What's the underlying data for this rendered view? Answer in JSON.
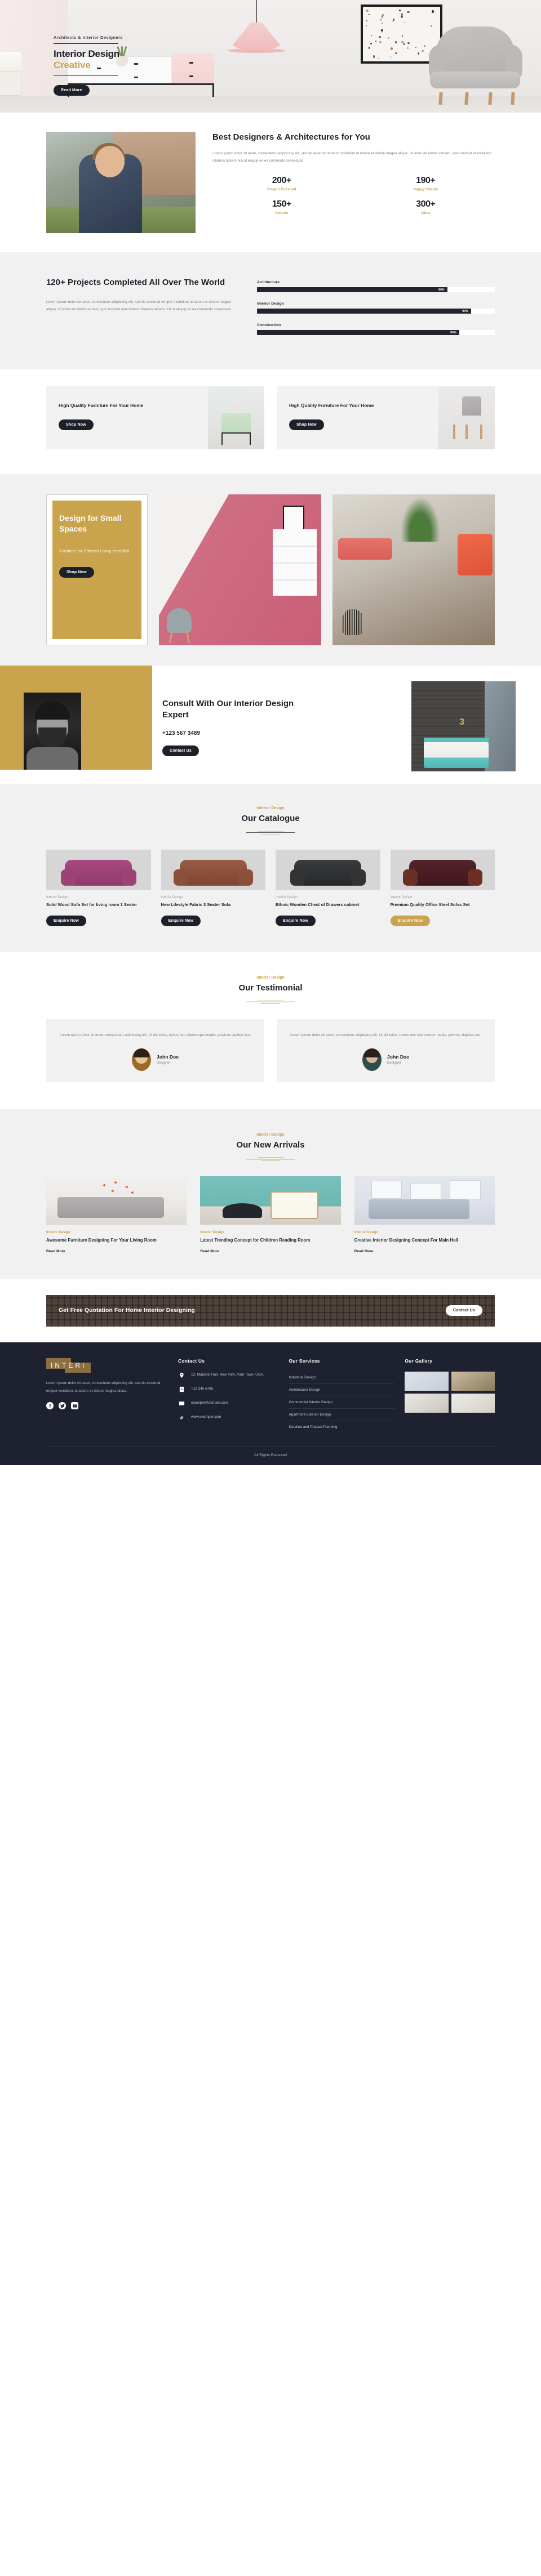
{
  "hero": {
    "eyebrow": "Architects & Interior Designers",
    "title_line1": "Interior Design",
    "title_line2": "Creative",
    "cta": "Read More"
  },
  "about": {
    "heading": "Best Designers & Architectures for You",
    "paragraph": "Lorem ipsum dolor sit amet, consectetur adipiscing elit, sed do eiusmod tempor incididunt ut labore et dolore magna aliqua. Ut enim ad minim veniam, quis nostrud exercitation ullamco laboris nisi ut aliquip ex ea commodo consequat.",
    "stats": [
      {
        "number": "200+",
        "label": "Project Finished"
      },
      {
        "number": "190+",
        "label": "Happy Clients"
      },
      {
        "number": "150+",
        "label": "Awards"
      },
      {
        "number": "300+",
        "label": "Likes"
      }
    ]
  },
  "projects": {
    "heading": "120+ Projects Completed All Over The World",
    "paragraph": "Lorem ipsum dolor sit amet, consectetur adipiscing elit, sed do eiusmod tempor incididunt ut labore et dolore magna aliqua. Ut enim ad minim veniam, quis nostrud exercitation ullamco laboris nisi ut aliquip ex ea commodo consequat."
  },
  "chart_data": {
    "type": "bar",
    "title": "120+ Projects Completed All Over The World",
    "categories": [
      "Architecture",
      "Interior Design",
      "Construction"
    ],
    "values": [
      80,
      90,
      85
    ],
    "value_labels": [
      "80%",
      "90%",
      "85%"
    ],
    "xlabel": "",
    "ylabel": "",
    "ylim": [
      0,
      100
    ],
    "orientation": "horizontal",
    "grid": false,
    "legend": false,
    "bar_color": "#22252d",
    "track_color": "#ffffff"
  },
  "promos": [
    {
      "heading": "High Quality Furniture For Your Home",
      "cta": "Shop Now"
    },
    {
      "heading": "High Quality Furniture For Your Home",
      "cta": "Shop Now"
    }
  ],
  "small_spaces": {
    "heading": "Design for Small Spaces",
    "subtext": "Furniture for Efficient Living from $68",
    "cta": "Shop Now"
  },
  "consult": {
    "heading": "Consult With Our Interior Design Expert",
    "phone": "+123 567 3489",
    "cta": "Contact Us",
    "room_number": "3"
  },
  "catalogue": {
    "eyebrow": "Interior Design",
    "title": "Our Catalogue",
    "items": [
      {
        "tag": "Interior Design",
        "name": "Solid Wood Sofa Set for living room 1 Seater",
        "cta": "Enquire Now",
        "highlighted": false
      },
      {
        "tag": "Interior Design",
        "name": "New Lifestyle Fabric 3 Seater Sofa",
        "cta": "Enquire Now",
        "highlighted": false
      },
      {
        "tag": "Interior Design",
        "name": "Ethnic Wooden Chest of Drawers cabinet",
        "cta": "Enquire Now",
        "highlighted": false
      },
      {
        "tag": "Interior Design",
        "name": "Premium Quality Office Steel Sofas Set",
        "cta": "Enquire Now",
        "highlighted": true
      }
    ]
  },
  "testimonial": {
    "eyebrow": "Interior Design",
    "title": "Our Testimonial",
    "items": [
      {
        "quote": "Lorem ipsum dolor sit amet, consectetur adipiscing elit. Ut elit tellus, luctus nec ullamcorper mattis, pulvinar dapibus leo.",
        "name": "John Doe",
        "role": "Designer"
      },
      {
        "quote": "Lorem ipsum dolor sit amet, consectetur adipiscing elit. Ut elit tellus, luctus nec ullamcorper mattis, pulvinar dapibus leo.",
        "name": "John Doe",
        "role": "Designer"
      }
    ]
  },
  "arrivals": {
    "eyebrow": "Interior Design",
    "title": "Our New Arrivals",
    "items": [
      {
        "tag": "Interior Design",
        "title": "Awesome Furniture Designing For Your Living Room",
        "cta": "Read More"
      },
      {
        "tag": "Interior Design",
        "title": "Latest Trending Concept for Children Reading Room",
        "cta": "Read More"
      },
      {
        "tag": "Interior Design",
        "title": "Creative Interior Designing Concept For Main Hall",
        "cta": "Read More"
      }
    ]
  },
  "cta_banner": {
    "heading": "Get Free Quotation For Home Interior Designing",
    "button": "Contact Us"
  },
  "footer": {
    "logo": "INTERI",
    "about": "Lorem ipsum dolor sit amet, consectetur adipiscing elit, sed do eiusmod tempor incididunt ut labore et dolore magna aliqua.",
    "contact_heading": "Contact Us",
    "contact": [
      {
        "icon": "location-pin-icon",
        "text": "12, Majestic Hall, New York, Park Town, USA."
      },
      {
        "icon": "phone-icon",
        "text": "+12 345 6785"
      },
      {
        "icon": "envelope-icon",
        "text": "example@domain.com"
      },
      {
        "icon": "link-icon",
        "text": "www.example.com"
      }
    ],
    "services_heading": "Our Services",
    "services": [
      "Industrial Design",
      "Architecture Design",
      "Commercial Interior Design",
      "Apartment Exterior Design",
      "Detailed and Phased Planning"
    ],
    "gallery_heading": "Our Gallery",
    "copyright": "All Rights Reserved"
  },
  "colors": {
    "gold": "#c9a44c",
    "dark": "#1d2029",
    "footer_bg": "#1e2230",
    "grey_bg": "#f1f1f1"
  }
}
